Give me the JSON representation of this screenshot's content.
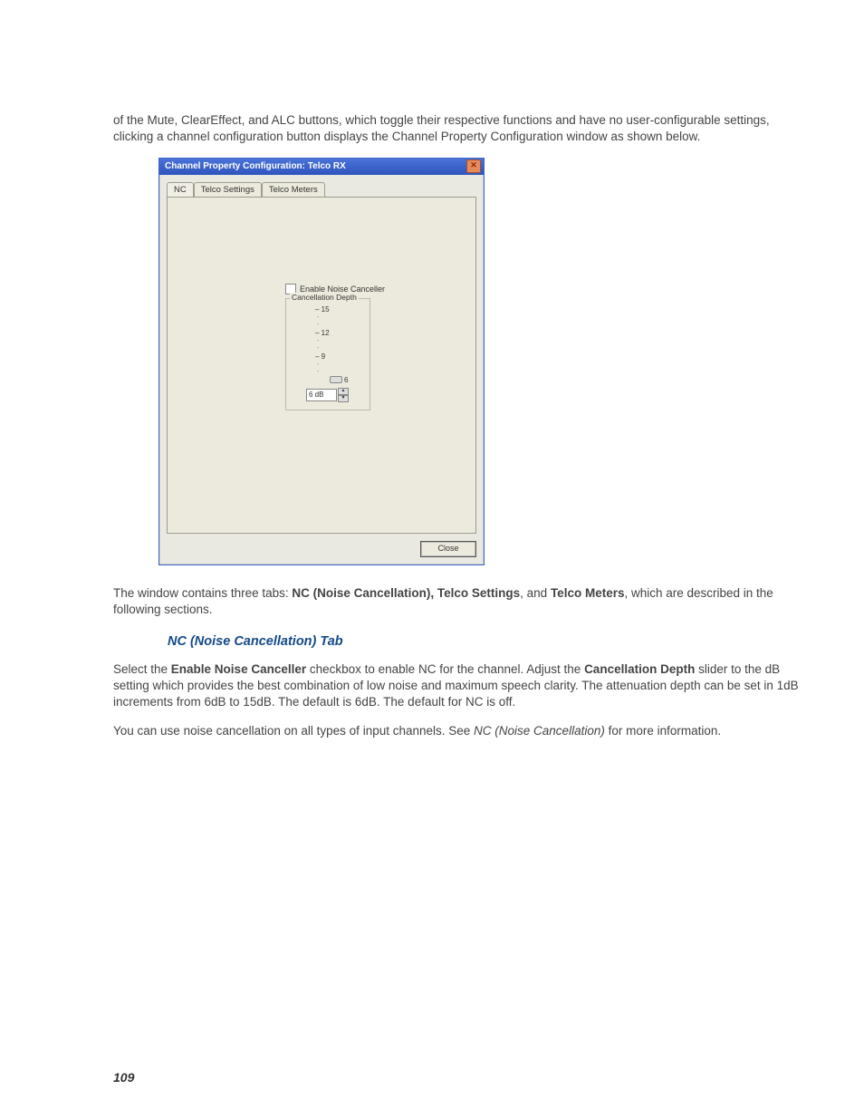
{
  "para1": "of the Mute, ClearEffect, and ALC buttons, which toggle their respective functions and have no user-configurable settings, clicking a channel configuration button displays the Channel Property Configuration window as shown below.",
  "dialog": {
    "title": "Channel Property Configuration: Telco RX",
    "tabs": [
      "NC",
      "Telco Settings",
      "Telco Meters"
    ],
    "checkbox_label": "Enable Noise Canceller",
    "depth_legend": "Cancellation Depth",
    "scale": {
      "m15": "– 15",
      "m12": "– 12",
      "m9": "– 9",
      "m6": "6"
    },
    "spinner_value": "6 dB",
    "close_label": "Close"
  },
  "para2_a": "The window contains three tabs: ",
  "para2_bold": "NC (Noise Cancellation), Telco Settings",
  "para2_b": ", and ",
  "para2_bold2": "Telco Meters",
  "para2_c": ", which are described in the following sections.",
  "heading_nc": "NC (Noise Cancellation) Tab",
  "para3_a": "Select the ",
  "para3_bold1": "Enable Noise Canceller",
  "para3_b": " checkbox to enable NC for the channel. Adjust the ",
  "para3_bold2": "Cancellation Depth",
  "para3_c": " slider to the dB setting which provides the best combination of low noise and maximum speech clarity. The attenuation depth can be set in 1dB increments from 6dB to 15dB. The default is 6dB. The default for NC is off.",
  "para4_a": "You can use noise cancellation on all types of input channels. See ",
  "para4_italic": "NC (Noise Cancellation)",
  "para4_b": " for more information.",
  "page_number": "109"
}
